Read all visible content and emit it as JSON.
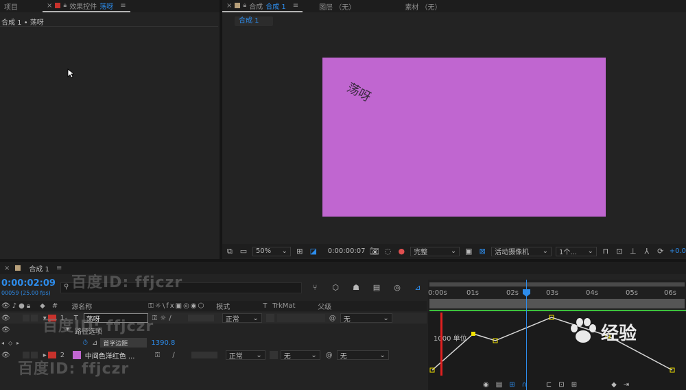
{
  "top_left": {
    "tab_project": "项目",
    "tab_effects_prefix": "效果控件",
    "tab_effects_layer": "荡呀",
    "breadcrumb": "合成 1 • 荡呀"
  },
  "top_right": {
    "tab_comp_prefix": "合成",
    "tab_comp_name": "合成 1",
    "tab_layer": "图层 （无）",
    "tab_footage": "素材 （无）",
    "comp_chip": "合成 1",
    "canvas_text": "荡呀",
    "canvas_color": "#c066d0"
  },
  "viewer_bar": {
    "zoom": "50%",
    "timecode": "0:00:00:07",
    "resolution": "完整",
    "camera": "活动摄像机",
    "views": "1个...",
    "exposure": "+0.0"
  },
  "timeline": {
    "tab": "合成 1",
    "timecode": "0:00:02:09",
    "frames": "00059 (25.00 fps)",
    "search_placeholder": "",
    "col_name": "源名称",
    "col_mode": "模式",
    "col_t": "T",
    "col_trkmat": "TrkMat",
    "col_parent": "父级",
    "layers": [
      {
        "num": "1",
        "name": "荡呀",
        "mode": "正常",
        "trkmat": "",
        "parent": "无",
        "color": "#c8322c",
        "type": "T"
      },
      {
        "num": "2",
        "name": "中间色洋红色 ...",
        "mode": "正常",
        "trkmat": "无",
        "parent": "无",
        "color": "#c8322c",
        "swatch": "#c066d0"
      }
    ],
    "sub_group": "路径选项",
    "property_label": "首字边距",
    "property_value": "1390.8",
    "ruler_ticks": [
      "0:00s",
      "01s",
      "02s",
      "03s",
      "04s",
      "05s",
      "06s"
    ],
    "graph_label": "1000 单位"
  },
  "watermarks": {
    "baidu": "百度ID: ffjczr",
    "jingyan": "经验"
  },
  "colors": {
    "accent_blue": "#2d8ceb",
    "keyframe_yellow": "#f2e200",
    "playhead_red": "#e02020",
    "graph_green": "#3cc23c"
  }
}
